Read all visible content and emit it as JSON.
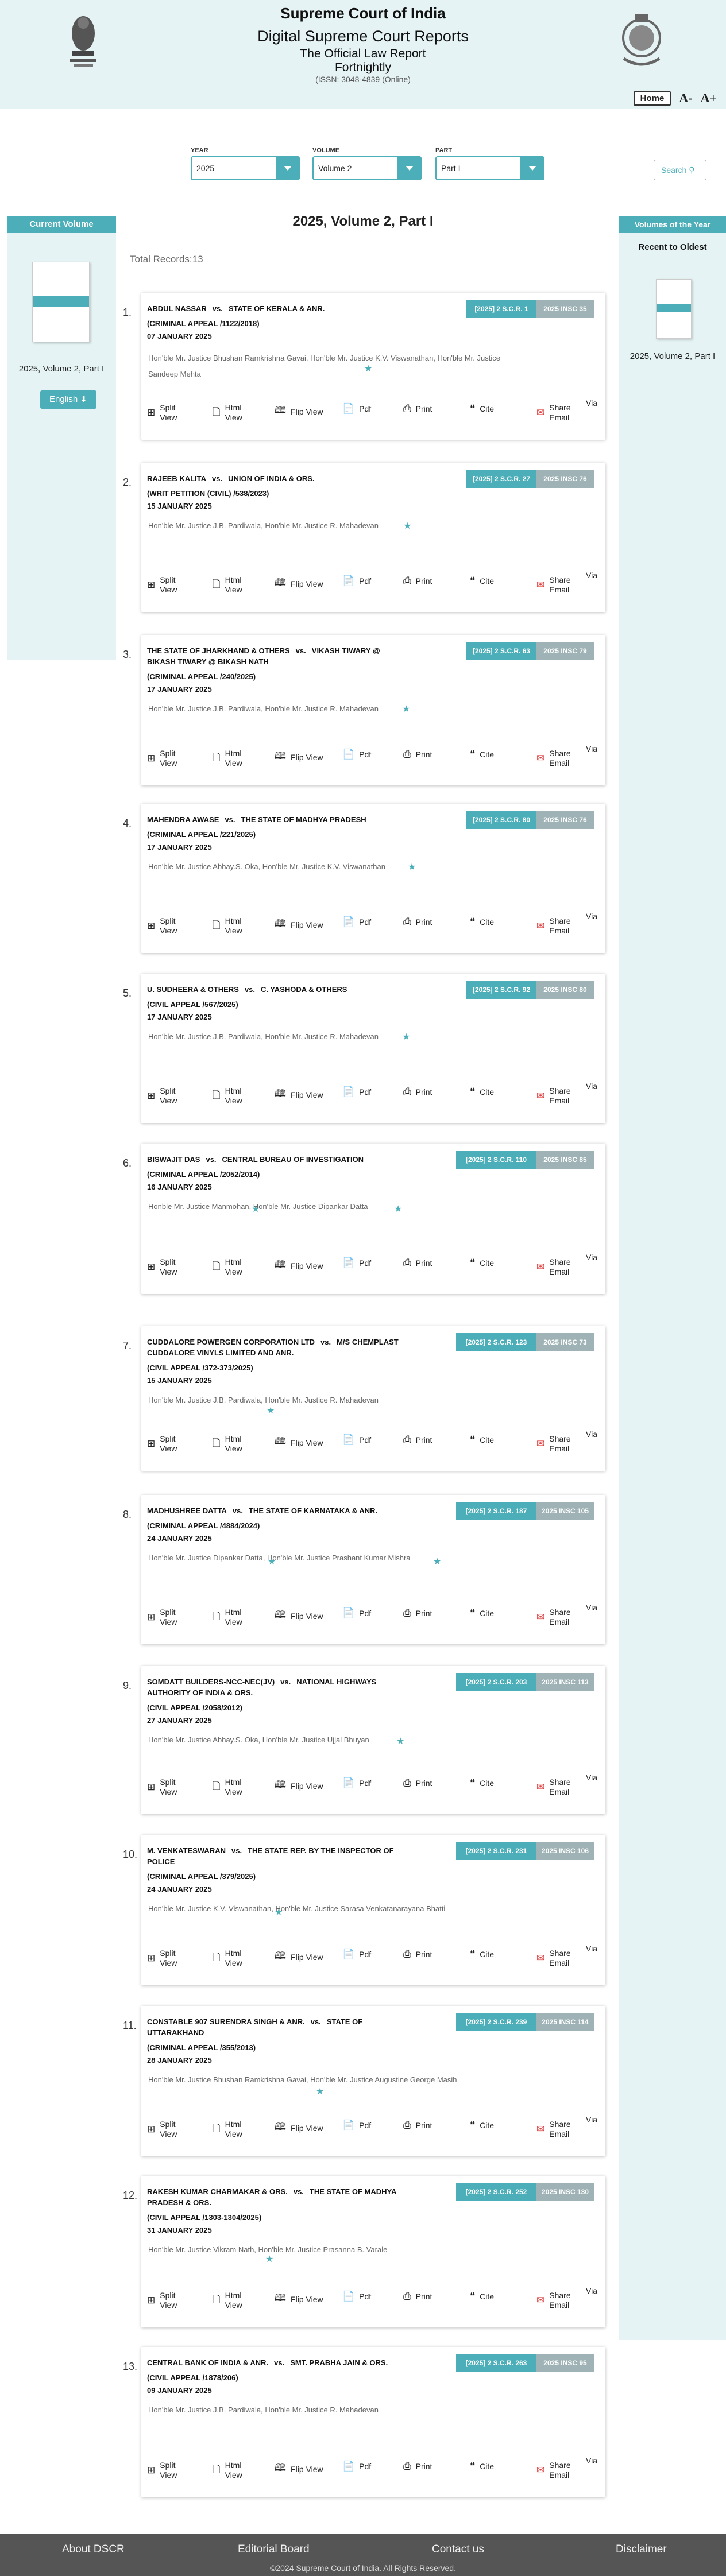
{
  "header": {
    "title": "Supreme Court of India",
    "subtitle": "Digital Supreme Court Reports",
    "line1": "The Official Law Report",
    "line2": "Fortnightly",
    "issn": "(ISSN: 3048-4839 (Online)",
    "home": "Home",
    "font_smaller": "A-",
    "font_larger": "A+"
  },
  "filters": {
    "year_label": "YEAR",
    "year_value": "2025",
    "volume_label": "VOLUME",
    "volume_value": "Volume 2",
    "part_label": "PART",
    "part_value": "Part I",
    "search_label": "Search"
  },
  "left_panel": {
    "title": "Current Volume",
    "volume": "2025, Volume 2, Part I",
    "language": "English"
  },
  "right_panel": {
    "title": "Volumes of the Year",
    "sort": "Recent to Oldest",
    "volume": "2025, Volume 2, Part I"
  },
  "main": {
    "title": "2025, Volume 2, Part I",
    "total_records": "Total Records:13"
  },
  "actions": {
    "split": [
      "Split",
      "View"
    ],
    "html": [
      "Html",
      "View"
    ],
    "flip": "Flip View",
    "pdf": "Pdf",
    "print": "Print",
    "cite": "Cite",
    "share": [
      "Share",
      "Email"
    ],
    "via": "Via"
  },
  "cases": [
    {
      "no": "1.",
      "petitioner": "ABDUL NASSAR",
      "respondent": "STATE OF KERALA & ANR.",
      "case_no": "(CRIMINAL APPEAL /1122/2018)",
      "date": "07 JANUARY 2025",
      "scr": "[2025] 2 S.C.R. 1",
      "insc": "2025 INSC 35",
      "judges": "Hon'ble Mr. Justice Bhushan Ramkrishna Gavai,  Hon'ble Mr. Justice K.V. Viswanathan,  Hon'ble Mr. Justice Sandeep Mehta"
    },
    {
      "no": "2.",
      "petitioner": "RAJEEB KALITA",
      "respondent": "UNION OF INDIA & ORS.",
      "case_no": "(WRIT PETITION (CIVIL) /538/2023)",
      "date": "15 JANUARY 2025",
      "scr": "[2025] 2 S.C.R. 27",
      "insc": "2025 INSC 76",
      "judges": "Hon'ble Mr. Justice J.B. Pardiwala, Hon'ble Mr. Justice R. Mahadevan"
    },
    {
      "no": "3.",
      "petitioner": "THE STATE OF JHARKHAND & OTHERS",
      "respondent": "VIKASH TIWARY @ BIKASH TIWARY @ BIKASH NATH",
      "case_no": "(CRIMINAL APPEAL /240/2025)",
      "date": "17 JANUARY 2025",
      "scr": "[2025] 2 S.C.R. 63",
      "insc": "2025 INSC 79",
      "judges": "Hon'ble Mr. Justice J.B. Pardiwala, Hon'ble Mr. Justice R. Mahadevan"
    },
    {
      "no": "4.",
      "petitioner": "MAHENDRA AWASE",
      "respondent": "THE STATE OF MADHYA PRADESH",
      "case_no": "(CRIMINAL APPEAL /221/2025)",
      "date": "17 JANUARY 2025",
      "scr": "[2025] 2 S.C.R. 80",
      "insc": "2025 INSC 76",
      "judges": "Hon'ble Mr. Justice Abhay.S. Oka, Hon'ble Mr. Justice K.V. Viswanathan"
    },
    {
      "no": "5.",
      "petitioner": "U. SUDHEERA & OTHERS",
      "respondent": "C. YASHODA & OTHERS",
      "case_no": "(CIVIL APPEAL /567/2025)",
      "date": "17 JANUARY 2025",
      "scr": "[2025] 2 S.C.R. 92",
      "insc": "2025 INSC 80",
      "judges": "Hon'ble Mr. Justice J.B. Pardiwala, Hon'ble Mr. Justice R. Mahadevan"
    },
    {
      "no": "6.",
      "petitioner": "BISWAJIT DAS",
      "respondent": "CENTRAL BUREAU OF INVESTIGATION",
      "case_no": "(CRIMINAL APPEAL /2052/2014)",
      "date": "16 JANUARY 2025",
      "scr": "[2025] 2 S.C.R. 110",
      "insc": "2025 INSC 85",
      "judges": "Honble Mr. Justice Manmohan, Hon'ble Mr. Justice Dipankar Datta"
    },
    {
      "no": "7.",
      "petitioner": "CUDDALORE POWERGEN CORPORATION LTD",
      "respondent": "M/S CHEMPLAST CUDDALORE VINYLS LIMITED AND ANR.",
      "case_no": "(CIVIL APPEAL /372-373/2025)",
      "date": "15 JANUARY 2025",
      "scr": "[2025] 2 S.C.R. 123",
      "insc": "2025 INSC 73",
      "judges": "Hon'ble Mr. Justice J.B. Pardiwala,  Hon'ble Mr. Justice R. Mahadevan"
    },
    {
      "no": "8.",
      "petitioner": "MADHUSHREE DATTA",
      "respondent": "THE STATE OF KARNATAKA & ANR.",
      "case_no": "(CRIMINAL APPEAL /4884/2024)",
      "date": "24 JANUARY 2025",
      "scr": "[2025] 2 S.C.R. 187",
      "insc": "2025 INSC 105",
      "judges": "Hon'ble Mr. Justice Dipankar Datta, Hon'ble Mr. Justice Prashant Kumar Mishra"
    },
    {
      "no": "9.",
      "petitioner": "SOMDATT BUILDERS-NCC-NEC(JV)",
      "respondent": "NATIONAL HIGHWAYS AUTHORITY OF INDIA & ORS.",
      "case_no": "(CIVIL APPEAL /2058/2012)",
      "date": "27 JANUARY 2025",
      "scr": "[2025] 2 S.C.R. 203",
      "insc": "2025 INSC 113",
      "judges": "Hon'ble Mr. Justice Abhay.S. Oka, Hon'ble Mr. Justice Ujjal Bhuyan"
    },
    {
      "no": "10.",
      "petitioner": "M. VENKATESWARAN",
      "respondent": "THE STATE REP. BY THE INSPECTOR OF POLICE",
      "case_no": "(CRIMINAL APPEAL /379/2025)",
      "date": "24 JANUARY 2025",
      "scr": "[2025] 2 S.C.R. 231",
      "insc": "2025 INSC 106",
      "judges": "Hon'ble Mr. Justice K.V. Viswanathan,  Hon'ble Mr. Justice Sarasa Venkatanarayana Bhatti"
    },
    {
      "no": "11.",
      "petitioner": "CONSTABLE 907 SURENDRA SINGH & ANR.",
      "respondent": "STATE OF UTTARAKHAND",
      "case_no": "(CRIMINAL APPEAL /355/2013)",
      "date": "28 JANUARY 2025",
      "scr": "[2025] 2 S.C.R. 239",
      "insc": "2025 INSC 114",
      "judges": "Hon'ble Mr. Justice Bhushan Ramkrishna Gavai,  Hon'ble Mr. Justice Augustine George Masih"
    },
    {
      "no": "12.",
      "petitioner": "RAKESH KUMAR CHARMAKAR & ORS.",
      "respondent": "THE STATE OF MADHYA PRADESH & ORS.",
      "case_no": "(CIVIL APPEAL /1303-1304/2025)",
      "date": "31 JANUARY 2025",
      "scr": "[2025] 2 S.C.R. 252",
      "insc": "2025 INSC 130",
      "judges": "Hon'ble Mr. Justice Vikram Nath,  Hon'ble Mr. Justice Prasanna B. Varale"
    },
    {
      "no": "13.",
      "petitioner": "CENTRAL BANK OF INDIA & ANR.",
      "respondent": "SMT. PRABHA JAIN & ORS.",
      "case_no": "(CIVIL APPEAL /1878/206)",
      "date": "09 JANUARY 2025",
      "scr": "[2025] 2 S.C.R. 263",
      "insc": "2025 INSC 95",
      "judges": "Hon'ble Mr. Justice J.B. Pardiwala,  Hon'ble Mr. Justice R. Mahadevan"
    }
  ],
  "footer": {
    "about": "About DSCR",
    "board": "Editorial Board",
    "contact": "Contact us",
    "disclaimer": "Disclaimer",
    "copyright": "©2024 Supreme Court of India. All Rights Reserved."
  }
}
